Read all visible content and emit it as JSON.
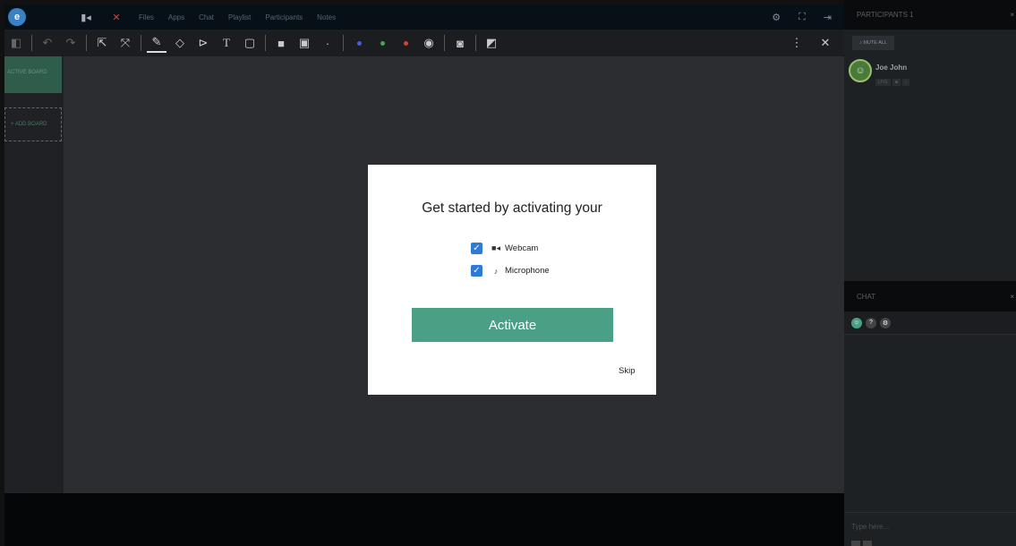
{
  "nav": {
    "logo_text": "",
    "links": [
      "Files",
      "Apps",
      "Chat",
      "Playlist",
      "Participants",
      "Notes"
    ]
  },
  "boards": {
    "active_label": "ACTIVE BOARD",
    "add_label": "+ ADD BOARD"
  },
  "participants_panel": {
    "title": "PARTICIPANTS 1",
    "close": "×",
    "mute_all": "MUTE ALL",
    "participant_name": "Joe John",
    "badges": [
      "LIVE",
      "■",
      "♪"
    ]
  },
  "chat_panel": {
    "title": "CHAT",
    "close": "×",
    "input_placeholder": "Type here..."
  },
  "modal": {
    "title": "Get started by activating your",
    "options": [
      {
        "label": "Webcam",
        "checked": true,
        "icon": "video-camera-icon"
      },
      {
        "label": "Microphone",
        "checked": true,
        "icon": "microphone-icon"
      }
    ],
    "activate_label": "Activate",
    "skip_label": "Skip"
  },
  "colors": {
    "accent": "#4aa084",
    "checkbox": "#2e7ad8",
    "topbar": "#071017",
    "canvas": "#2b2d30"
  }
}
